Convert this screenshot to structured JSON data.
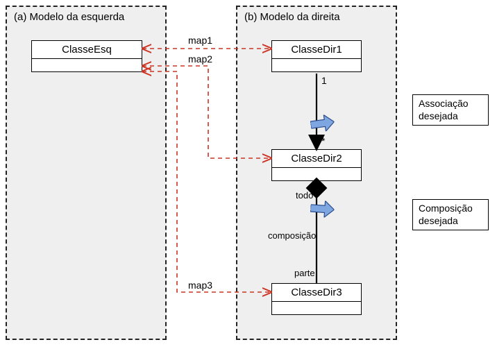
{
  "panels": {
    "left": {
      "title": "(a) Modelo da esquerda"
    },
    "right": {
      "title": "(b) Modelo da direita"
    }
  },
  "classes": {
    "esq": {
      "name": "ClasseEsq"
    },
    "dir1": {
      "name": "ClasseDir1"
    },
    "dir2": {
      "name": "ClasseDir2"
    },
    "dir3": {
      "name": "ClasseDir3"
    }
  },
  "mappings": {
    "map1": "map1",
    "map2": "map2",
    "map3": "map3"
  },
  "relationLabels": {
    "mult_one": "1",
    "mult_many": "*",
    "todo": "todo",
    "composicao": "composição",
    "parte": "parte"
  },
  "notes": {
    "association": {
      "line1": "Associação",
      "line2": "desejada"
    },
    "composition": {
      "line1": "Composição",
      "line2": "desejada"
    }
  }
}
